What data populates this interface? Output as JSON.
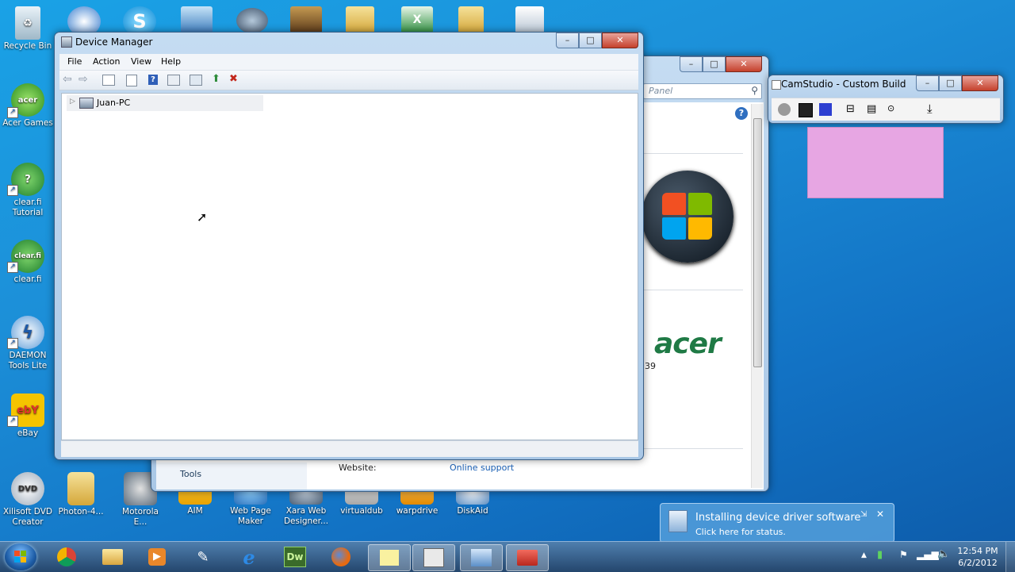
{
  "desktop_icons": [
    {
      "label": "Recycle Bin",
      "icon": "recycle-bin-icon"
    },
    {
      "label": "Acer Games",
      "icon": "acer-games-icon"
    },
    {
      "label": "clear.fi Tutorial",
      "icon": "clearfi-tutorial-icon"
    },
    {
      "label": "clear.fi",
      "icon": "clearfi-icon"
    },
    {
      "label": "DAEMON Tools Lite",
      "icon": "daemon-tools-icon"
    },
    {
      "label": "eBay",
      "icon": "ebay-icon"
    },
    {
      "label": "Xilisoft DVD Creator",
      "icon": "xilisoft-icon"
    },
    {
      "label": "Photon-4...",
      "icon": "folder-icon"
    },
    {
      "label": "Motorola E...",
      "icon": "motorola-icon"
    },
    {
      "label": "AIM",
      "icon": "aim-icon"
    },
    {
      "label": "Web Page Maker",
      "icon": "web-page-maker-icon"
    },
    {
      "label": "Xara Web Designer...",
      "icon": "xara-icon"
    },
    {
      "label": "virtualdub",
      "icon": "virtualdub-icon"
    },
    {
      "label": "warpdrive",
      "icon": "warpdrive-icon"
    },
    {
      "label": "DiskAid",
      "icon": "diskaid-icon"
    }
  ],
  "device_manager": {
    "title": "Device Manager",
    "menu": [
      "File",
      "Action",
      "View",
      "Help"
    ],
    "tree_root": "Juan-PC"
  },
  "system_window": {
    "search_placeholder": "Panel",
    "tools_label": "Tools",
    "website_label": "Website:",
    "website_link": "Online support",
    "brand": "acer",
    "partial_text": "39"
  },
  "camstudio": {
    "title": "CamStudio - Custom Build"
  },
  "notification": {
    "title": "Installing device driver software",
    "subtitle": "Click here for status."
  },
  "taskbar": {
    "time": "12:54 PM",
    "date": "6/2/2012",
    "dw_label": "Dw"
  },
  "colors": {
    "desktop": "#1c8fd8",
    "taskbar": "#2f5a86",
    "sticky": "#e6a4e2"
  }
}
